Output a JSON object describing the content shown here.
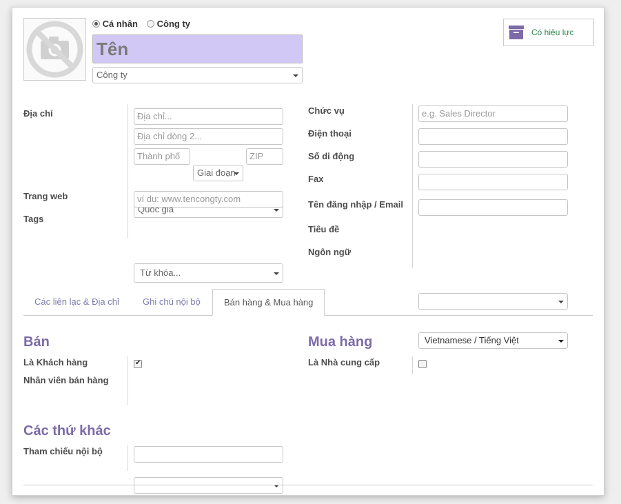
{
  "header": {
    "type_options": [
      {
        "label": "Cá nhân",
        "selected": true
      },
      {
        "label": "Công ty",
        "selected": false
      }
    ],
    "name_placeholder": "Tên",
    "company_placeholder": "Công ty",
    "archive_label": "Có hiệu lực"
  },
  "left_fields": {
    "address_label": "Địa chỉ",
    "street_placeholder": "Địa chỉ...",
    "street2_placeholder": "Địa chỉ dòng 2...",
    "city_placeholder": "Thành phố",
    "state_placeholder": "Giai đoạn",
    "zip_placeholder": "ZIP",
    "country_placeholder": "Quốc gia",
    "website_label": "Trang web",
    "website_placeholder": "ví dụ: www.tencongty.com",
    "tags_label": "Tags",
    "tags_placeholder": "Từ khóa..."
  },
  "right_fields": {
    "job_label": "Chức vụ",
    "job_placeholder": "e.g. Sales Director",
    "phone_label": "Điện thoại",
    "mobile_label": "Số di động",
    "fax_label": "Fax",
    "login_label": "Tên đăng nhập / Email",
    "title_label": "Tiêu đề",
    "lang_label": "Ngôn ngữ",
    "lang_value": "Vietnamese / Tiếng Việt"
  },
  "tabs": [
    {
      "label": "Các liên lạc & Địa chỉ",
      "active": false
    },
    {
      "label": "Ghi chú nội bộ",
      "active": false
    },
    {
      "label": "Bán hàng & Mua hàng",
      "active": true
    }
  ],
  "sales": {
    "title": "Bán",
    "customer_label": "Là Khách hàng",
    "customer_checked": true,
    "salesperson_label": "Nhân viên bán hàng"
  },
  "purchase": {
    "title": "Mua hàng",
    "supplier_label": "Là Nhà cung cấp",
    "supplier_checked": false
  },
  "misc": {
    "title": "Các thứ khác",
    "ref_label": "Tham chiếu nội bộ"
  },
  "colors": {
    "accent": "#7c6ba8",
    "name_bg": "#d2c8f6",
    "archive_text": "#2f8a4f"
  }
}
